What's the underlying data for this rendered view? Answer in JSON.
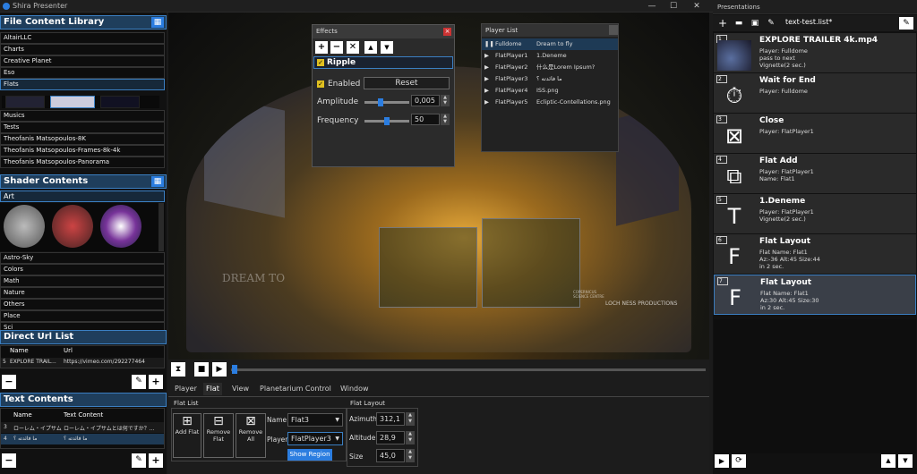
{
  "window": {
    "title": "Shira Presenter",
    "min": "—",
    "max": "☐",
    "close": "✕"
  },
  "file_library": {
    "title": "File Content Library",
    "items": [
      "AltairLLC",
      "Charts",
      "Creative Planet",
      "Eso",
      "Flats"
    ],
    "items2": [
      "Musics",
      "Tests",
      "Theofanis Matsopoulos-8K",
      "Theofanis Matsopoulos-Frames-8k-4k",
      "Theofanis Matsopoulos-Panorama"
    ]
  },
  "shader": {
    "title": "Shader Contents",
    "selected": "Art",
    "categories": [
      "Astro-Sky",
      "Colors",
      "Math",
      "Nature",
      "Others",
      "Place",
      "Sci"
    ]
  },
  "direct_url": {
    "title": "Direct Url List",
    "col_name": "Name",
    "col_url": "Url",
    "row_num": "5",
    "row_name": "EXPLORE TRAIL...",
    "row_url": "https://vimeo.com/292277464"
  },
  "text_contents": {
    "title": "Text Contents",
    "col_name": "Name",
    "col_text": "Text Content",
    "rows": [
      {
        "num": "3",
        "name": "ローレム・イプサム...",
        "text": "ローレム・イプサムとは何ですか？..."
      },
      {
        "num": "4",
        "name": "ما فائدته ؟",
        "text": "ما فائدته ؟"
      }
    ]
  },
  "effects": {
    "title": "Effects",
    "effect_name": "Ripple",
    "enabled_label": "Enabled",
    "reset_label": "Reset",
    "amplitude_label": "Amplitude",
    "amplitude_value": "0,005",
    "frequency_label": "Frequency",
    "frequency_value": "50",
    "amplitude_level": 0.35,
    "frequency_level": 0.5
  },
  "player_list": {
    "title": "Player List",
    "rows": [
      {
        "player": "Fulldome",
        "content": "Dream to fly"
      },
      {
        "player": "FlatPlayer1",
        "content": "1.Deneme"
      },
      {
        "player": "FlatPlayer2",
        "content": "什么是Lorem Ipsum?"
      },
      {
        "player": "FlatPlayer3",
        "content": "ما فائدته ؟"
      },
      {
        "player": "FlatPlayer4",
        "content": "ISS.png"
      },
      {
        "player": "FlatPlayer5",
        "content": "Ecliptic-Contellations.png"
      }
    ]
  },
  "dome_text": {
    "dream": "DREAM TO",
    "loch": "LOCH NESS PRODUCTIONS",
    "planetarium": "COPERNICUS SCIENCE CENTRE"
  },
  "tabs": [
    "Player",
    "Flat",
    "View",
    "Planetarium Control",
    "Window"
  ],
  "flat_list": {
    "title": "Flat List",
    "add": "Add Flat",
    "remove": "Remove Flat",
    "remove_all": "Remove All",
    "name_label": "Name",
    "name_value": "Flat3",
    "player_label": "Player",
    "player_value": "FlatPlayer3",
    "show_region": "Show Region"
  },
  "flat_layout": {
    "title": "Flat Layout",
    "azimuth_label": "Azimuth",
    "azimuth_value": "312,1",
    "altitude_label": "Altitude",
    "altitude_value": "28,9",
    "size_label": "Size",
    "size_value": "45,0"
  },
  "presentations": {
    "panel_title": "Presentations",
    "file": "text-test.list*",
    "items": [
      {
        "num": "1",
        "title": "EXPLORE TRAILER 4k.mp4",
        "lines": [
          "Player: Fulldome",
          "pass to next",
          "Vignette(2 sec.)"
        ],
        "icon": "video-thumb-icon"
      },
      {
        "num": "2",
        "title": "Wait for End",
        "lines": [
          "Player: Fulldome"
        ],
        "icon": "stopwatch-icon"
      },
      {
        "num": "3",
        "title": "Close",
        "lines": [
          "Player: FlatPlayer1"
        ],
        "icon": "close-doc-icon"
      },
      {
        "num": "4",
        "title": "Flat Add",
        "lines": [
          "Player: FlatPlayer1",
          "Name: Flat1"
        ],
        "icon": "flat-add-icon"
      },
      {
        "num": "5",
        "title": "1.Deneme",
        "lines": [
          "Player: FlatPlayer1",
          "Vignette(2 sec.)"
        ],
        "icon": "text-icon"
      },
      {
        "num": "6",
        "title": "Flat Layout",
        "lines": [
          "Flat Name: Flat1",
          "Az:-36 Alt:45 Size:44",
          "in 2 sec."
        ],
        "icon": "layout-icon"
      },
      {
        "num": "7",
        "title": "Flat Layout",
        "lines": [
          "Flat Name: Flat1",
          "Az:30 Alt:45 Size:30",
          "in 2 sec."
        ],
        "icon": "layout-icon"
      }
    ]
  },
  "colors": {
    "accent": "#2b7de0",
    "header_bg": "#1f3e5c"
  }
}
